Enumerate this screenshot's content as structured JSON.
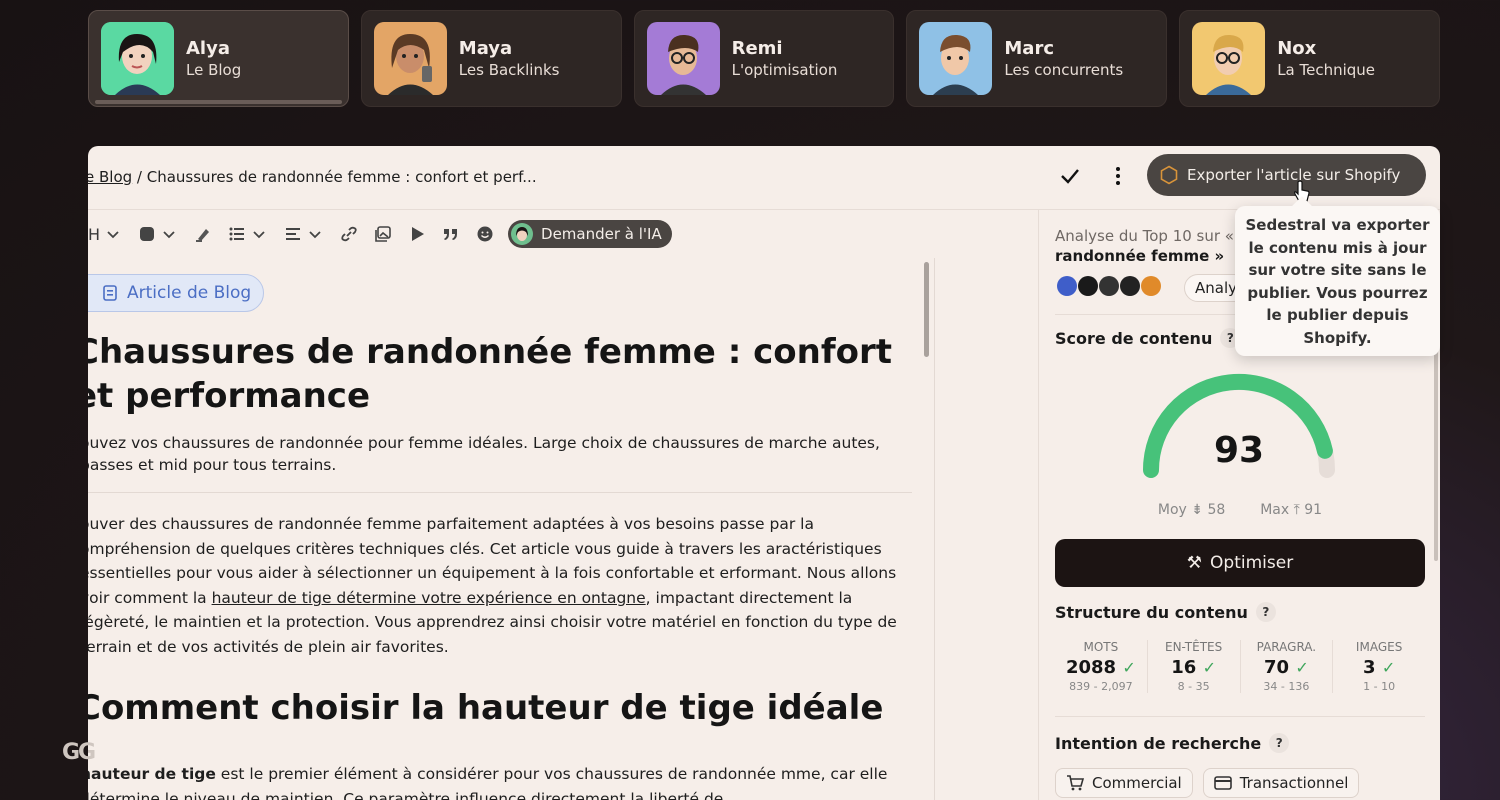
{
  "agents": [
    {
      "name": "Alya",
      "role": "Le Blog",
      "color": "#4fd39a",
      "active": true
    },
    {
      "name": "Maya",
      "role": "Les Backlinks",
      "color": "#e7b071",
      "active": false
    },
    {
      "name": "Remi",
      "role": "L'optimisation",
      "color": "#a77ed9",
      "active": false
    },
    {
      "name": "Marc",
      "role": "Les concurrents",
      "color": "#8fc1e6",
      "active": false
    },
    {
      "name": "Nox",
      "role": "La Technique",
      "color": "#f2c870",
      "active": false
    }
  ],
  "breadcrumb": {
    "parent": "e Blog",
    "separator": " / ",
    "current": "Chaussures de randonnée femme : confort et perf..."
  },
  "header": {
    "export_label": "Exporter l'article sur Shopify"
  },
  "toolbar": {
    "heading_label": "H",
    "ask_ai_label": "Demander à l'IA"
  },
  "editor": {
    "tag_label": "Article de Blog",
    "title": "Chaussures de randonnée femme : confort et performance",
    "intro": "ouvez vos chaussures de randonnée pour femme idéales. Large choix de chaussures de marche autes, basses et mid pour tous terrains.",
    "para_before_link": "ouver des chaussures de randonnée femme parfaitement adaptées à vos besoins passe par la ompréhension de quelques critères techniques clés. Cet article vous guide à travers les aractéristiques essentielles pour vous aider à sélectionner un équipement à la fois confortable et erformant. Nous allons voir comment la ",
    "link_text": "hauteur de tige détermine votre expérience en ontagne",
    "para_after_link": ", impactant directement la légèreté, le maintien et la protection. Vous apprendrez ainsi choisir votre matériel en fonction du type de terrain et de vos activités de plein air favorites.",
    "h2": "Comment choisir la hauteur de tige idéale",
    "para2_bold": "hauteur de tige",
    "para2_rest": " est le premier élément à considérer pour vos chaussures de randonnée mme, car elle détermine le niveau de maintien. Ce paramètre influence directement la liberté de"
  },
  "sidebar": {
    "analysis_prefix": "Analyse du Top 10 sur «",
    "analysis_keyword": "randonnée femme »",
    "analyze_label": "Analy",
    "score_title": "Score de contenu",
    "score": 93,
    "score_fraction": 0.93,
    "avg_label": "Moy",
    "avg_value": "58",
    "max_label": "Max",
    "max_value": "91",
    "optimize_label": "Optimiser",
    "structure_title": "Structure du contenu",
    "structure": [
      {
        "label": "MOTS",
        "value": "2088",
        "range": "839 - 2,097"
      },
      {
        "label": "EN-TÊTES",
        "value": "16",
        "range": "8 - 35"
      },
      {
        "label": "PARAGRA.",
        "value": "70",
        "range": "34 - 136"
      },
      {
        "label": "IMAGES",
        "value": "3",
        "range": "1 - 10"
      }
    ],
    "intent_title": "Intention de recherche",
    "intents": [
      "Commercial",
      "Transactionnel"
    ],
    "tooltip": "Sedestral va exporter le contenu mis à jour sur votre site sans le publier. Vous pourrez le publier depuis Shopify."
  },
  "colors": {
    "accent_green": "#47c27a",
    "dark": "#1c1413",
    "tag_blue": "#4b6ec4"
  }
}
